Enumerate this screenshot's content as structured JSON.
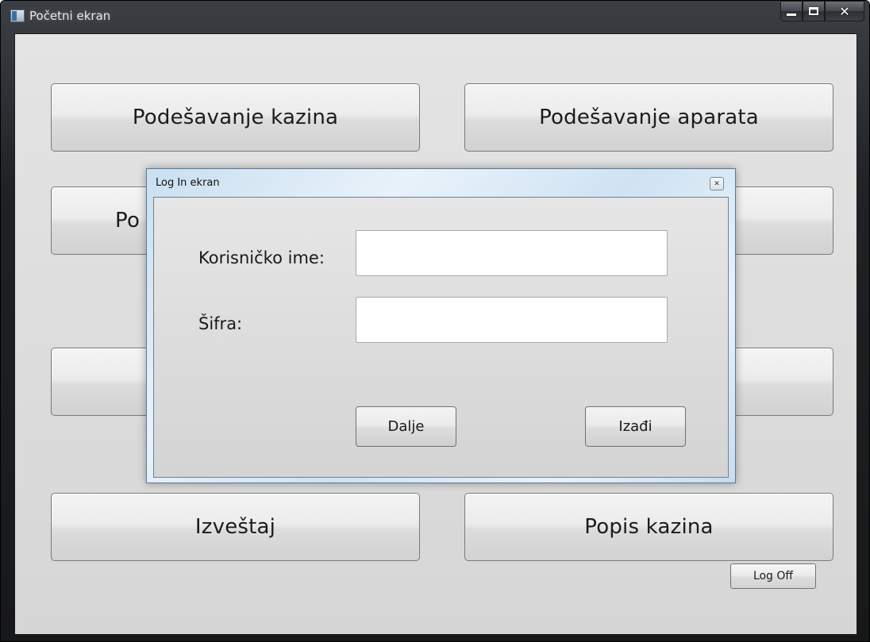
{
  "main_window": {
    "title": "Početni ekran",
    "buttons": {
      "setup_casino": "Podešavanje kazina",
      "setup_machines": "Podešavanje aparata",
      "row2_left_visible": "Po",
      "report": "Izveštaj",
      "casino_list": "Popis kazina",
      "log_off": "Log Off"
    },
    "caption": {
      "minimize_icon": "minimize-icon",
      "maximize_icon": "maximize-icon",
      "close_icon": "close-icon",
      "close_glyph": "✕"
    }
  },
  "login_dialog": {
    "title": "Log In ekran",
    "close_glyph": "✕",
    "username_label": "Korisničko ime:",
    "username_value": "",
    "password_label": "Šifra:",
    "password_value": "",
    "next_button": "Dalje",
    "exit_button": "Izađi"
  }
}
